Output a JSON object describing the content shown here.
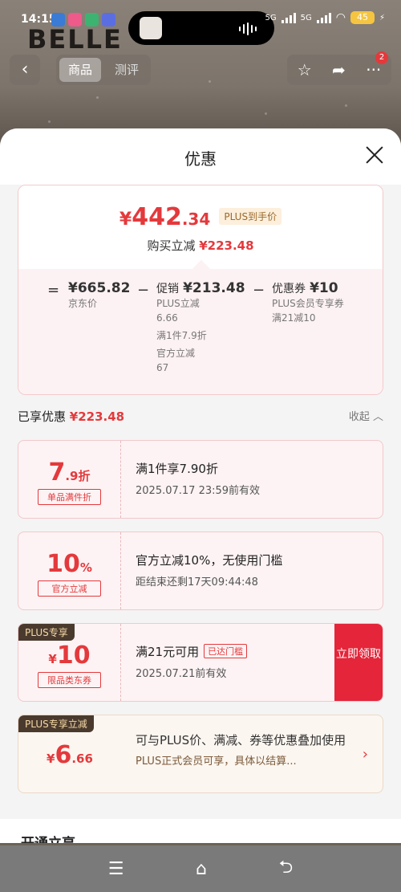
{
  "status": {
    "time": "14:15",
    "sig1": "5G",
    "sig2": "5G",
    "battery": "45"
  },
  "background": {
    "brand": "BELLE",
    "tab_product": "商品",
    "tab_review": "测评",
    "cart_badge": "2"
  },
  "sheet": {
    "title": "优惠",
    "summary": {
      "yen": "¥",
      "price_int": "442",
      "price_dec": ".34",
      "plus_tag": "PLUS到手价",
      "save_label": "购买立减",
      "save_amount": "¥223.48",
      "eq": "=",
      "minus1": "−",
      "minus2": "−",
      "jd_price": "¥665.82",
      "jd_label": "京东价",
      "promo_label": "促销",
      "promo_amount": "¥213.48",
      "promo_items": [
        "PLUS立减",
        "6.66",
        "满1件7.9折",
        "官方立减",
        "67"
      ],
      "coupon_label": "优惠券",
      "coupon_amount": "¥10",
      "coupon_items": [
        "PLUS会员专享券",
        "满21减10"
      ]
    },
    "enjoyed": {
      "label": "已享优惠",
      "amount": "¥223.48",
      "collapse": "收起 ︿"
    },
    "coupons": [
      {
        "value_main": "7",
        "value_suffix": ".9折",
        "tag": "单品满件折",
        "line1": "满1件享7.90折",
        "line2": "2025.07.17 23:59前有效"
      },
      {
        "value_main": "10",
        "value_suffix": "%",
        "tag": "官方立减",
        "line1": "官方立减10%，无使用门槛",
        "line2": "距结束还剩17天09:44:48"
      },
      {
        "badge": "PLUS专享",
        "value_prefix": "¥",
        "value_main": "10",
        "tag": "限品类东券",
        "line1": "满21元可用",
        "reached": "已达门槛",
        "line2": "2025.07.21前有效",
        "claim": "立即领取"
      },
      {
        "badge": "PLUS专享立减",
        "value_prefix": "¥",
        "value_main": "6",
        "value_suffix": ".66",
        "line1": "可与PLUS价、满减、券等优惠叠加使用",
        "line2": "PLUS正式会员可享，具体以结算..."
      }
    ],
    "open_section": "开通立享"
  },
  "navbar": {
    "menu": "☰",
    "home": "⌂",
    "back": "⮌"
  }
}
